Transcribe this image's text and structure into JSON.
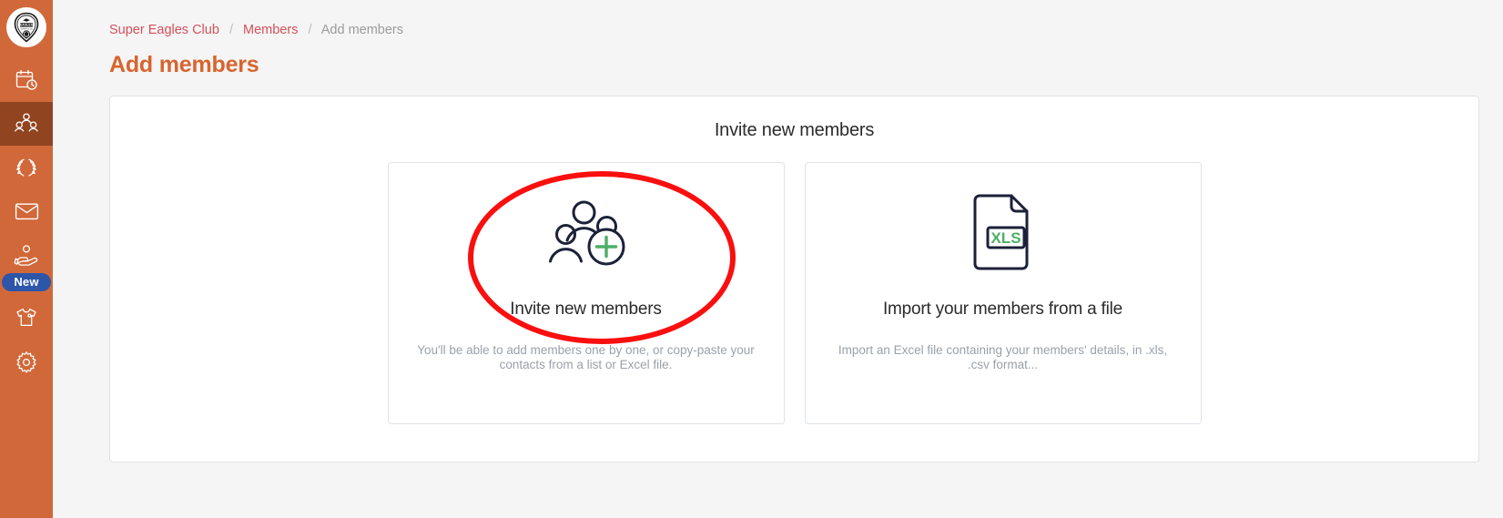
{
  "sidebar": {
    "logo": {
      "name": "eagles-club-logo",
      "text": "EAGLES"
    },
    "items": [
      {
        "icon": "calendar-clock-icon",
        "label": "Events",
        "active": false
      },
      {
        "icon": "members-group-icon",
        "label": "Members",
        "active": true
      },
      {
        "icon": "laurel-wreath-icon",
        "label": "Competitions",
        "active": false
      },
      {
        "icon": "envelope-icon",
        "label": "Messages",
        "active": false
      },
      {
        "icon": "donation-hand-icon",
        "label": "Donations",
        "active": false
      },
      {
        "icon": "tshirt-icon",
        "label": "Shop",
        "active": false
      },
      {
        "icon": "gear-icon",
        "label": "Settings",
        "active": false
      }
    ],
    "badge": {
      "label": "New",
      "color": "#2d55a8"
    }
  },
  "breadcrumb": {
    "items": [
      {
        "label": "Super Eagles Club",
        "link": true
      },
      {
        "label": "Members",
        "link": true
      },
      {
        "label": "Add members",
        "link": false
      }
    ],
    "separator": "/"
  },
  "page": {
    "title": "Add members",
    "title_color": "#d9642f"
  },
  "panel": {
    "heading": "Invite new members",
    "cards": [
      {
        "icon": "people-add-icon",
        "title": "Invite new members",
        "description": "You'll be able to add members one by one, or copy-paste your contacts from a list or Excel file.",
        "highlighted": true
      },
      {
        "icon": "xls-file-icon",
        "icon_label": "XLS",
        "title": "Import your members from a file",
        "description": "Import an Excel file containing your members' details, in .xls, .csv format...",
        "highlighted": false
      }
    ]
  },
  "annotation": {
    "shape": "ellipse",
    "color": "#fa0f0f",
    "targets": "invite-new-members-card"
  }
}
